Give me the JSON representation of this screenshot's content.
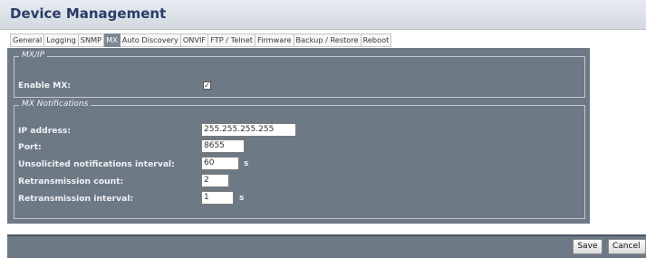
{
  "header": {
    "title": "Device Management"
  },
  "tabs": [
    {
      "label": "General",
      "active": false
    },
    {
      "label": "Logging",
      "active": false
    },
    {
      "label": "SNMP",
      "active": false
    },
    {
      "label": "MX",
      "active": true
    },
    {
      "label": "Auto Discovery",
      "active": false
    },
    {
      "label": "ONVIF",
      "active": false
    },
    {
      "label": "FTP / Telnet",
      "active": false
    },
    {
      "label": "Firmware",
      "active": false
    },
    {
      "label": "Backup / Restore",
      "active": false
    },
    {
      "label": "Reboot",
      "active": false
    }
  ],
  "mxip": {
    "legend": "MX/IP",
    "enable_label": "Enable MX:",
    "enable_checked": true
  },
  "notifications": {
    "legend": "MX Notifications",
    "ip_label": "IP address:",
    "ip_value": "255.255.255.255",
    "port_label": "Port:",
    "port_value": "8655",
    "interval_label": "Unsolicited notifications interval:",
    "interval_value": "60",
    "interval_unit": "s",
    "retrans_count_label": "Retransmission count:",
    "retrans_count_value": "2",
    "retrans_interval_label": "Retransmission interval:",
    "retrans_interval_value": "1",
    "retrans_interval_unit": "s"
  },
  "footer": {
    "save_label": "Save",
    "cancel_label": "Cancel"
  },
  "colors": {
    "panel": "#6e7986",
    "title_text": "#2b3c66",
    "active_tab": "#7d8896"
  }
}
